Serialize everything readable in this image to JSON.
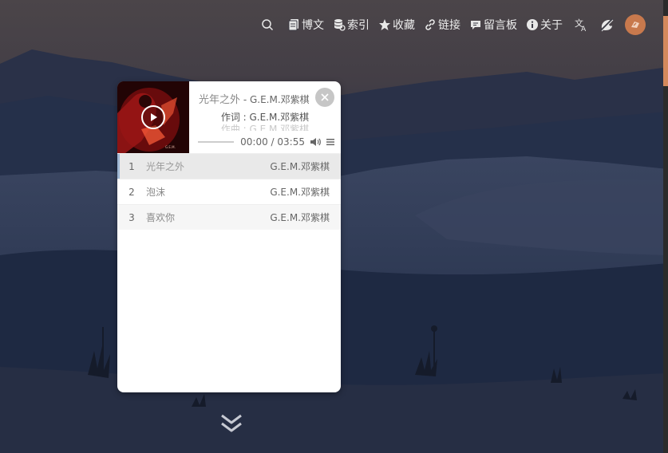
{
  "nav": {
    "items": [
      {
        "label": "",
        "icon": "search-icon"
      },
      {
        "label": "博文",
        "icon": "copy-icon"
      },
      {
        "label": "索引",
        "icon": "database-icon"
      },
      {
        "label": "收藏",
        "icon": "star-icon"
      },
      {
        "label": "链接",
        "icon": "link-icon"
      },
      {
        "label": "留言板",
        "icon": "comment-icon"
      },
      {
        "label": "关于",
        "icon": "info-icon"
      }
    ],
    "translate_icon": "translate-icon",
    "theme_icon": "theme-toggle-icon"
  },
  "player": {
    "song": "光年之外",
    "artist_sep": " - G.E.M.邓紫棋",
    "lyric_1": "作词 : G.E.M.邓紫棋",
    "lyric_2": "作曲 : G.E.M.邓紫棋",
    "time": "00:00 / 03:55",
    "tracks": [
      {
        "num": "1",
        "name": "光年之外",
        "artist": "G.E.M.邓紫棋"
      },
      {
        "num": "2",
        "name": "泡沫",
        "artist": "G.E.M.邓紫棋"
      },
      {
        "num": "3",
        "name": "喜欢你",
        "artist": "G.E.M.邓紫棋"
      }
    ],
    "progress": 0
  },
  "colors": {
    "accent": "#d4895c",
    "avatar": "#c8794d"
  }
}
